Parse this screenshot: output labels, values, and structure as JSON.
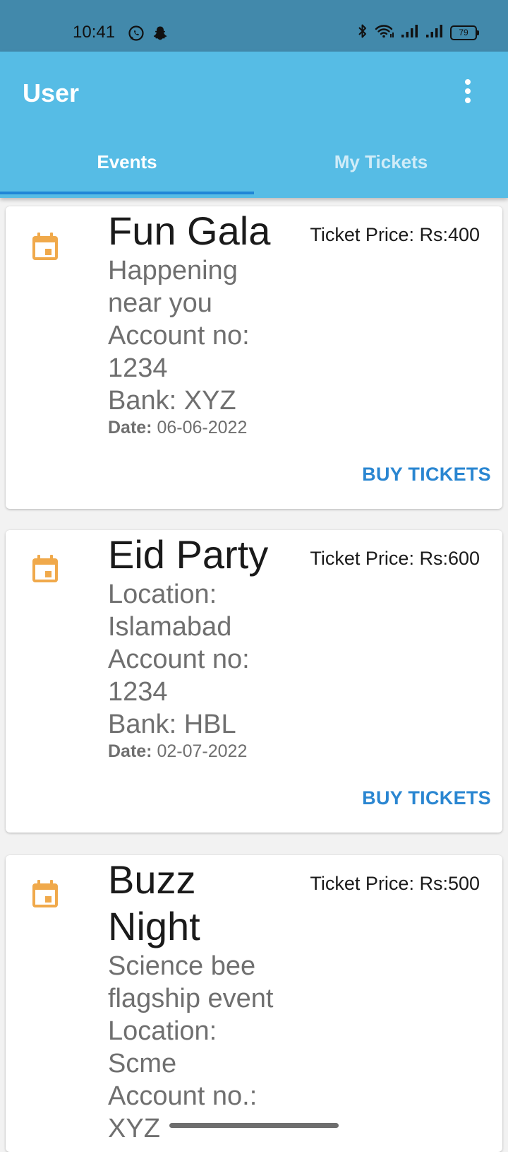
{
  "status_bar": {
    "time": "10:41",
    "battery": "79",
    "left_icons": [
      "whatsapp-icon",
      "snapchat-icon"
    ],
    "right_icons": [
      "bluetooth-icon",
      "wifi-icon",
      "signal-icon",
      "signal-icon"
    ]
  },
  "app_bar": {
    "title": "User",
    "menu_icon": "more-vert-icon"
  },
  "tabs": [
    {
      "label": "Events",
      "active": true
    },
    {
      "label": "My Tickets",
      "active": false
    }
  ],
  "colors": {
    "status_bar": "#4289ab",
    "app_bar": "#56bce5",
    "accent": "#2a86d1",
    "tab_indicator": "#1f86d6",
    "calendar_icon": "#f0a94b"
  },
  "events": [
    {
      "title": "Fun Gala",
      "details": "Happening\nnear you\nAccount no:\n1234\nBank: XYZ",
      "date_label": "Date:",
      "date": "06-06-2022",
      "price": "Ticket Price: Rs:400",
      "button": "BUY TICKETS"
    },
    {
      "title": "Eid Party",
      "details": "Location:\nIslamabad\nAccount no:\n1234\nBank: HBL",
      "date_label": "Date:",
      "date": "02-07-2022",
      "price": "Ticket Price: Rs:600",
      "button": "BUY TICKETS"
    },
    {
      "title": "Buzz Night",
      "details": "Science bee\nflagship event\nLocation:\nScme\nAccount no.:\nXYZ",
      "price": "Ticket Price: Rs:500"
    }
  ]
}
